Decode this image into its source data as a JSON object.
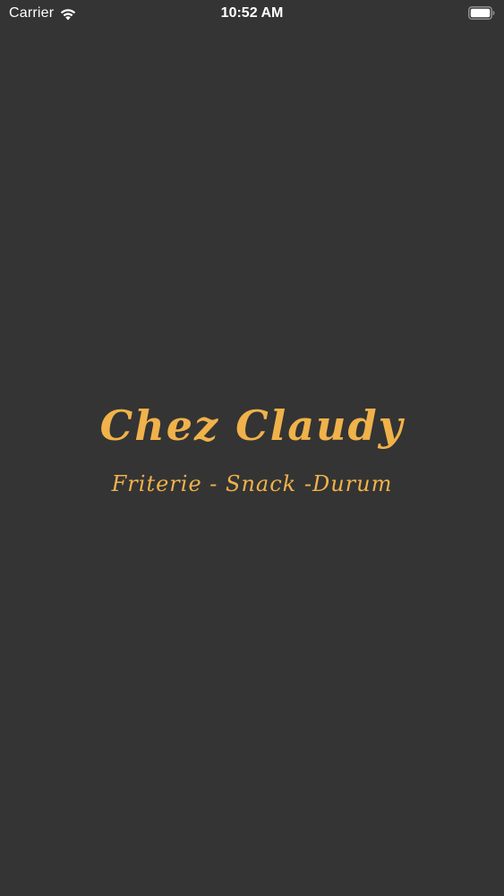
{
  "status_bar": {
    "carrier": "Carrier",
    "time": "10:52 AM",
    "icons": {
      "signal": "wifi-icon",
      "battery": "battery-icon"
    }
  },
  "splash": {
    "title": "Chez Claudy",
    "subtitle": "Friterie - Snack -Durum"
  },
  "colors": {
    "background": "#343434",
    "accent": "#f0b24a",
    "status_text": "#ffffff"
  }
}
